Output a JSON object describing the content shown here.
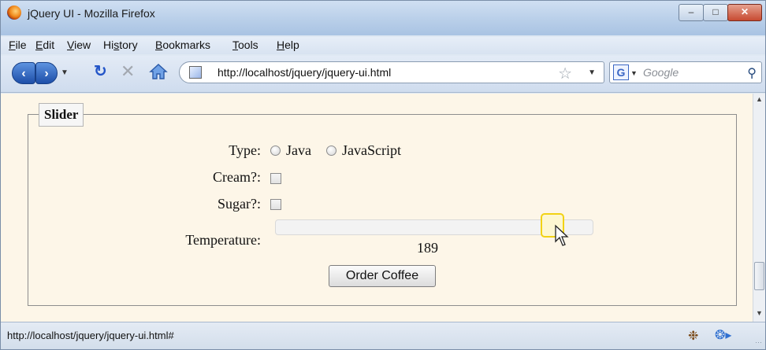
{
  "window": {
    "title": "jQuery UI - Mozilla Firefox"
  },
  "menu": {
    "items": [
      {
        "ul": "F",
        "rest": "ile"
      },
      {
        "ul": "E",
        "rest": "dit"
      },
      {
        "ul": "V",
        "rest": "iew"
      },
      {
        "pre": "Hi",
        "ul": "s",
        "rest": "tory"
      },
      {
        "ul": "B",
        "rest": "ookmarks"
      },
      {
        "ul": "T",
        "rest": "ools"
      },
      {
        "ul": "H",
        "rest": "elp"
      }
    ]
  },
  "nav": {
    "url": "http://localhost/jquery/jquery-ui.html",
    "search_placeholder": "Google"
  },
  "form": {
    "legend": "Slider",
    "type_label": "Type:",
    "type_options": [
      "Java",
      "JavaScript"
    ],
    "cream_label": "Cream?:",
    "sugar_label": "Sugar?:",
    "temperature_label": "Temperature:",
    "temperature_value": "189",
    "order_button": "Order Coffee"
  },
  "status": {
    "text": "http://localhost/jquery/jquery-ui.html#"
  }
}
